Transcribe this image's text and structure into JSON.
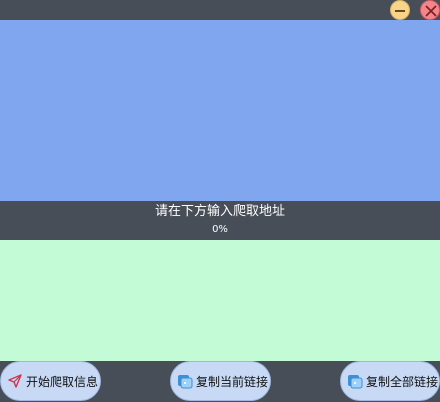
{
  "window": {
    "minimize_label": "",
    "close_label": ""
  },
  "output": {
    "text": ""
  },
  "prompt_text": "请在下方输入爬取地址",
  "progress_text": "0%",
  "input": {
    "value": "",
    "placeholder": ""
  },
  "buttons": {
    "start": "开始爬取信息",
    "copy_current": "复制当前链接",
    "copy_all": "复制全部链接"
  },
  "colors": {
    "background": "#474e58",
    "output_area": "#7fa6ef",
    "input_area": "#c2fbd6",
    "button": "#c7d9f5",
    "minimize": "#f7d48a",
    "close": "#f3868a"
  },
  "icons": {
    "start": "send-arrow-icon",
    "copy_current": "copy-icon",
    "copy_all": "copy-icon",
    "minimize": "minimize-icon",
    "close": "close-icon"
  }
}
